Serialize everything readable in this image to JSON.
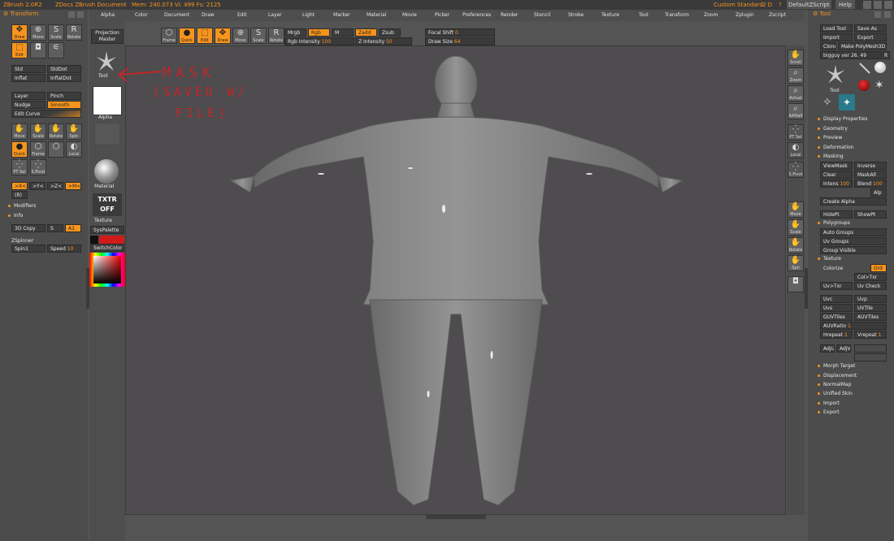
{
  "titlebar": {
    "app": "ZBrush 2.0R2",
    "doc": "ZDocs ZBrush Document",
    "mem": "Mem: 240.073  Vi: 499  Fs: 2125",
    "layout": "Custom",
    "standard": "Standard",
    "zd": "2 D",
    "q": "?",
    "script": "DefaultZScript",
    "help": "Help"
  },
  "menu": [
    "Alpha",
    "Color",
    "Document",
    "Draw",
    "Edit",
    "Layer",
    "Light",
    "Marker",
    "Material",
    "Movie",
    "Picker",
    "Preferences",
    "Render",
    "Stencil",
    "Stroke",
    "Texture",
    "Tool",
    "Transform",
    "Zoom",
    "Zplugin",
    "Zscript"
  ],
  "left": {
    "title": "Transform",
    "row1": [
      "Draw",
      "Move",
      "Scale",
      "Rotate"
    ],
    "row2": [
      "Edit",
      "",
      ""
    ],
    "std": "Std",
    "stddot": "StdDot",
    "inflat": "Inflat",
    "inflatdot": "InflatDot",
    "layer": "Layer",
    "pinch": "Pinch",
    "nudge": "Nudge",
    "smooth": "Smooth",
    "editcurve": "Edit Curve",
    "row3": [
      "Move",
      "Scale",
      "Rotate",
      "Spin"
    ],
    "row4": [
      "Quick",
      "Frame",
      "",
      "Local"
    ],
    "row5": [
      "PT Sel",
      "S.Pivot"
    ],
    "axes": [
      ">X<",
      ">Y<",
      ">Z<",
      ">M<"
    ],
    "r": "(R)",
    "modifiers": "Modifiers",
    "info": "Info",
    "copy": "3D Copy",
    "s": "S",
    "a1": "A1",
    "zspinner": "ZSpinner",
    "spin1": "Spin1",
    "speed": "Speed",
    "speed_val": "10"
  },
  "palette": {
    "projection": "Projection Master",
    "tool": "Tool",
    "alpha": "Alpha",
    "material": "Material",
    "txtr": "TXTR OFF",
    "texture": "Texture",
    "syspalette": "SysPalette",
    "switchcolor": "SwitchColor"
  },
  "toptools": {
    "frame": "Frame",
    "quick": "Quick",
    "edit": "Edit",
    "draw": "Draw",
    "move": "Move",
    "scale": "Scale",
    "rotate": "Rotate",
    "mrgb": "Mrgb",
    "rgb": "Rgb",
    "m": "M",
    "zadd": "Zadd",
    "zsub": "Zsub",
    "rgb_int": "Rgb Intensity",
    "rgb_int_val": "100",
    "z_int": "Z Intensity",
    "z_int_val": "50",
    "focal": "Focal Shift",
    "focal_val": "0",
    "drawsize": "Draw Size",
    "drawsize_val": "64"
  },
  "annotation": [
    "MASK",
    "(SAVED W/",
    "FILE)"
  ],
  "rightnav": [
    "Scroll",
    "Zoom",
    "Actual",
    "AAHalf",
    "PT Sel",
    "Local",
    "S.Pivot",
    "Move",
    "Scale",
    "Rotate",
    "Sph",
    ""
  ],
  "tool": {
    "title": "Tool",
    "load": "Load Tool",
    "save": "Save As",
    "import": "Import",
    "export": "Export",
    "clone": "Clone",
    "make": "Make PolyMesh3D",
    "name": "bigguy ver 26. 49",
    "r": "R",
    "toolpick": "Tool",
    "sections": [
      "Display Properties",
      "Geometry",
      "Preview",
      "Deformation",
      "Masking"
    ],
    "viewmask": "ViewMask",
    "inverse": "Inverse",
    "clear": "Clear",
    "maskall": "MaskAll",
    "intens": "Intens",
    "intens_val": "100",
    "blend": "Blend",
    "blend_val": "100",
    "alp": "Alp",
    "createalpha": "Create Alpha",
    "hidept": "HidePt",
    "showpt": "ShowPt",
    "polygroups": "Polygroups",
    "autogroups": "Auto Groups",
    "uvgroups": "Uv Groups",
    "groupvisible": "Group Visible",
    "texture": "Texture",
    "colorize": "Colorize",
    "grd": "Grd",
    "coltxr": "Col>Txr",
    "uvtxr": "Uv>Txr",
    "uvcheck": "Uv Check",
    "uvc": "Uvc",
    "uvp": "Uvp",
    "uvs": "Uvs",
    "uvtile": "UVTile",
    "guvtiles": "GUVTiles",
    "auvtiles": "AUVTiles",
    "auvratio": "AUVRatio",
    "auvratio_val": "1",
    "hrepeat": "Hrepeat",
    "hrepeat_val": "1",
    "vrepeat": "Vrepeat",
    "vrepeat_val": "1",
    "adju": "AdjU",
    "adjv": "AdjV",
    "more": [
      "Morph Target",
      "Displacement",
      "NormalMap",
      "Unified Skin",
      "Import",
      "Export"
    ]
  }
}
